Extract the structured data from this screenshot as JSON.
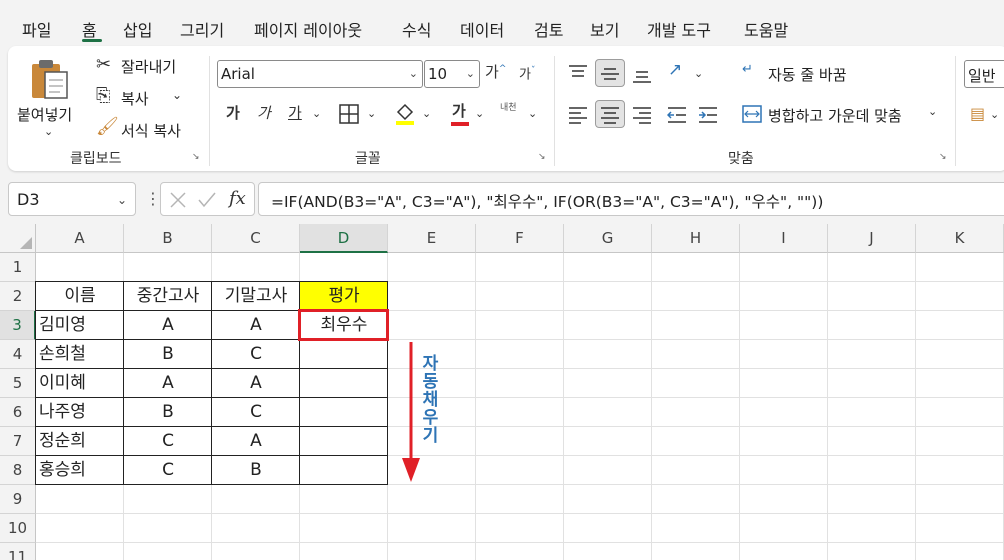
{
  "menu": {
    "tabs": [
      "파일",
      "홈",
      "삽입",
      "그리기",
      "페이지 레이아웃",
      "수식",
      "데이터",
      "검토",
      "보기",
      "개발 도구",
      "도움말"
    ],
    "active": "홈"
  },
  "ribbon": {
    "clipboard": {
      "paste": "붙여넣기",
      "cut": "잘라내기",
      "copy": "복사",
      "format_painter": "서식 복사",
      "label": "클립보드"
    },
    "font": {
      "font_name": "Arial",
      "font_size": "10",
      "bold": "가",
      "italic": "가",
      "underline": "가",
      "bigger": "가",
      "smaller": "가",
      "phonetic": "내천",
      "label": "글꼴"
    },
    "alignment": {
      "wrap_text": "자동 줄 바꿈",
      "merge_center": "병합하고 가운데 맞춤",
      "label": "맞춤"
    },
    "number": {
      "format": "일반"
    }
  },
  "formula_bar": {
    "name_box": "D3",
    "fx": "fx",
    "formula": "=IF(AND(B3=\"A\", C3=\"A\"), \"최우수\", IF(OR(B3=\"A\", C3=\"A\"), \"우수\", \"\"))"
  },
  "sheet": {
    "columns": [
      "A",
      "B",
      "C",
      "D",
      "E",
      "F",
      "G",
      "H",
      "I",
      "J",
      "K"
    ],
    "rows": [
      "1",
      "2",
      "3",
      "4",
      "5",
      "6",
      "7",
      "8",
      "9",
      "10",
      "11"
    ],
    "headers": [
      "이름",
      "중간고사",
      "기말고사",
      "평가"
    ],
    "data": [
      [
        "김미영",
        "A",
        "A",
        "최우수"
      ],
      [
        "손희철",
        "B",
        "C",
        ""
      ],
      [
        "이미혜",
        "A",
        "A",
        ""
      ],
      [
        "나주영",
        "B",
        "C",
        ""
      ],
      [
        "정순희",
        "C",
        "A",
        ""
      ],
      [
        "홍승희",
        "C",
        "B",
        ""
      ]
    ],
    "selected_cell": "D3",
    "annotation": "자동채우기"
  },
  "colors": {
    "accent": "#1e7145",
    "header_fill": "#ffff00",
    "selection": "#e02027",
    "annotation": "#2e74b5",
    "arrow": "#e02027"
  }
}
